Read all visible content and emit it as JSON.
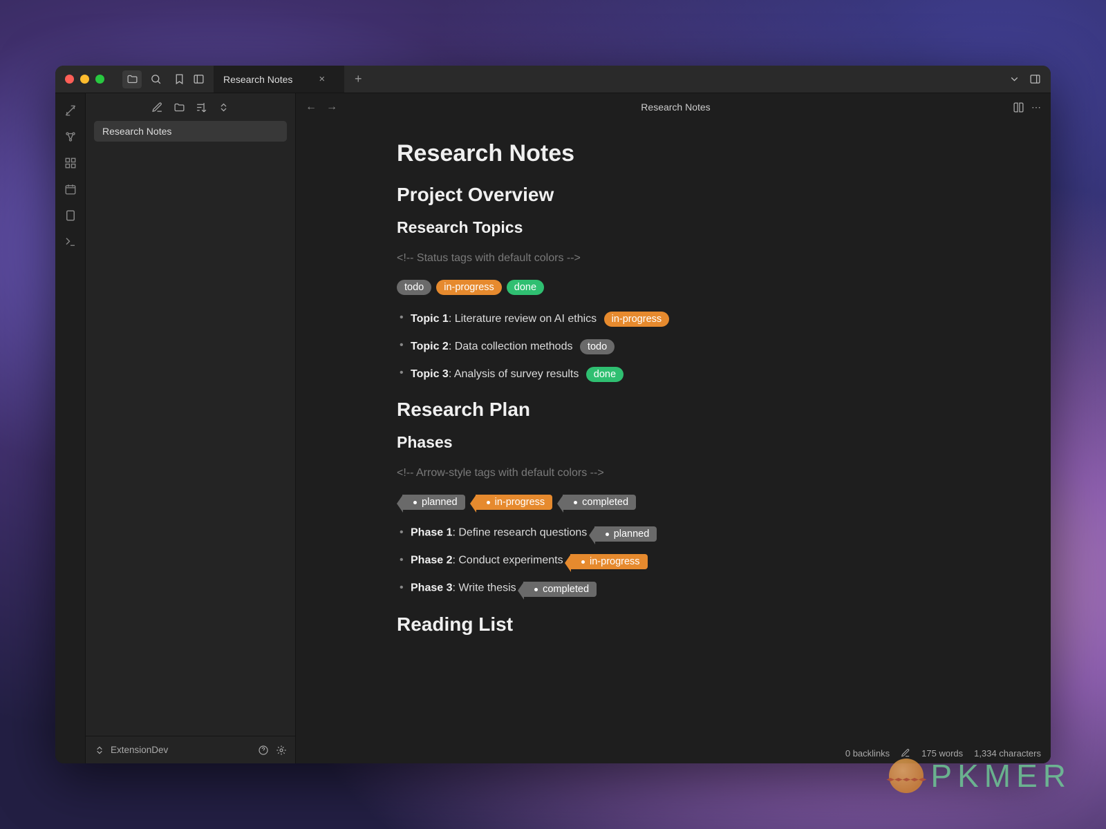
{
  "tab": {
    "label": "Research Notes"
  },
  "sidebar": {
    "file": "Research Notes",
    "vault": "ExtensionDev"
  },
  "header": {
    "title": "Research Notes"
  },
  "doc": {
    "h1": "Research Notes",
    "h2_overview": "Project Overview",
    "h3_topics": "Research Topics",
    "comment1": "<!-- Status tags with default colors -->",
    "pills": {
      "todo": "todo",
      "inprogress": "in-progress",
      "done": "done"
    },
    "topics": [
      {
        "label": "Topic 1",
        "text": ": Literature review on AI ethics",
        "tag": "in-progress",
        "cls": "orange",
        "style": "pill"
      },
      {
        "label": "Topic 2",
        "text": ": Data collection methods",
        "tag": "todo",
        "cls": "gray",
        "style": "pill"
      },
      {
        "label": "Topic 3",
        "text": ": Analysis of survey results",
        "tag": "done",
        "cls": "green",
        "style": "pill"
      }
    ],
    "h2_plan": "Research Plan",
    "h3_phases": "Phases",
    "comment2": "<!-- Arrow-style tags with default colors -->",
    "arrows": {
      "planned": "planned",
      "inprogress": "in-progress",
      "completed": "completed"
    },
    "phases": [
      {
        "label": "Phase 1",
        "text": ": Define research questions",
        "tag": "planned",
        "cls": "gray",
        "style": "arrow"
      },
      {
        "label": "Phase 2",
        "text": ": Conduct experiments",
        "tag": "in-progress",
        "cls": "orange",
        "style": "arrow"
      },
      {
        "label": "Phase 3",
        "text": ": Write thesis",
        "tag": "completed",
        "cls": "gray",
        "style": "arrow"
      }
    ],
    "h2_reading": "Reading List"
  },
  "status": {
    "backlinks": "0 backlinks",
    "words": "175 words",
    "chars": "1,334 characters"
  },
  "watermark": "PKMER"
}
